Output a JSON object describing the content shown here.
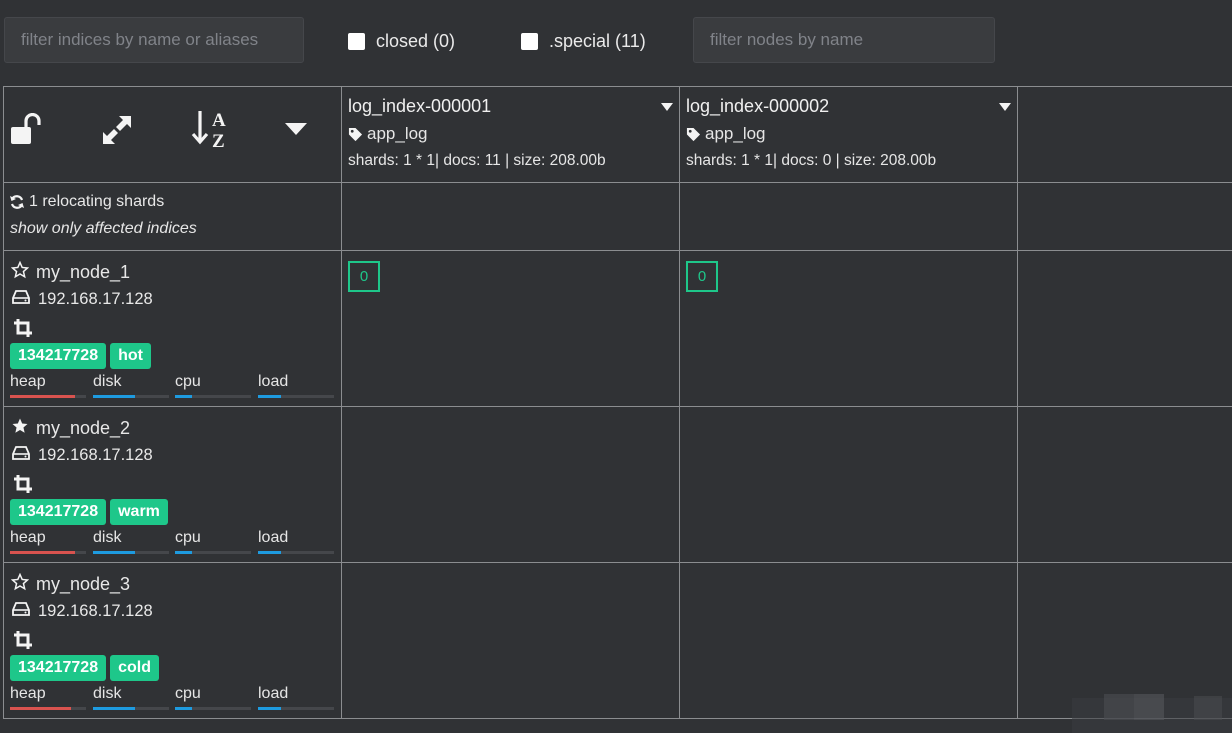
{
  "toolbar": {
    "filter_indices_placeholder": "filter indices by name or aliases",
    "closed_label": "closed (0)",
    "special_label": ".special (11)",
    "filter_nodes_placeholder": "filter nodes by name"
  },
  "header_controls": {
    "icons": [
      "unlock-icon",
      "expand-icon",
      "sort-alpha-icon",
      "caret-down-icon"
    ]
  },
  "indices": [
    {
      "name": "log_index-000001",
      "alias": "app_log",
      "stats": "shards: 1 * 1| docs: 11 | size: 208.00b"
    },
    {
      "name": "log_index-000002",
      "alias": "app_log",
      "stats": "shards: 1 * 1| docs: 0 | size: 208.00b"
    }
  ],
  "relocating": {
    "label": "1 relocating shards",
    "filter_label": "show only affected indices"
  },
  "metric_labels": {
    "heap": "heap",
    "disk": "disk",
    "cpu": "cpu",
    "load": "load"
  },
  "colors": {
    "accent_green": "#1ec78a",
    "heap": "#d9534f",
    "disk": "#1e9be0",
    "cpu": "#1e9be0",
    "load": "#1e9be0"
  },
  "nodes": [
    {
      "name": "my_node_1",
      "master_icon": "star-outline-icon",
      "ip": "192.168.17.128",
      "badges": [
        "134217728",
        "hot"
      ],
      "heap": 0.85,
      "disk": 0.55,
      "cpu": 0.22,
      "load": 0.3,
      "shards": [
        "0",
        "0"
      ]
    },
    {
      "name": "my_node_2",
      "master_icon": "star-filled-icon",
      "ip": "192.168.17.128",
      "badges": [
        "134217728",
        "warm"
      ],
      "heap": 0.85,
      "disk": 0.55,
      "cpu": 0.22,
      "load": 0.3,
      "shards": []
    },
    {
      "name": "my_node_3",
      "master_icon": "star-outline-icon",
      "ip": "192.168.17.128",
      "badges": [
        "134217728",
        "cold"
      ],
      "heap": 0.8,
      "disk": 0.55,
      "cpu": 0.22,
      "load": 0.3,
      "shards": []
    }
  ]
}
